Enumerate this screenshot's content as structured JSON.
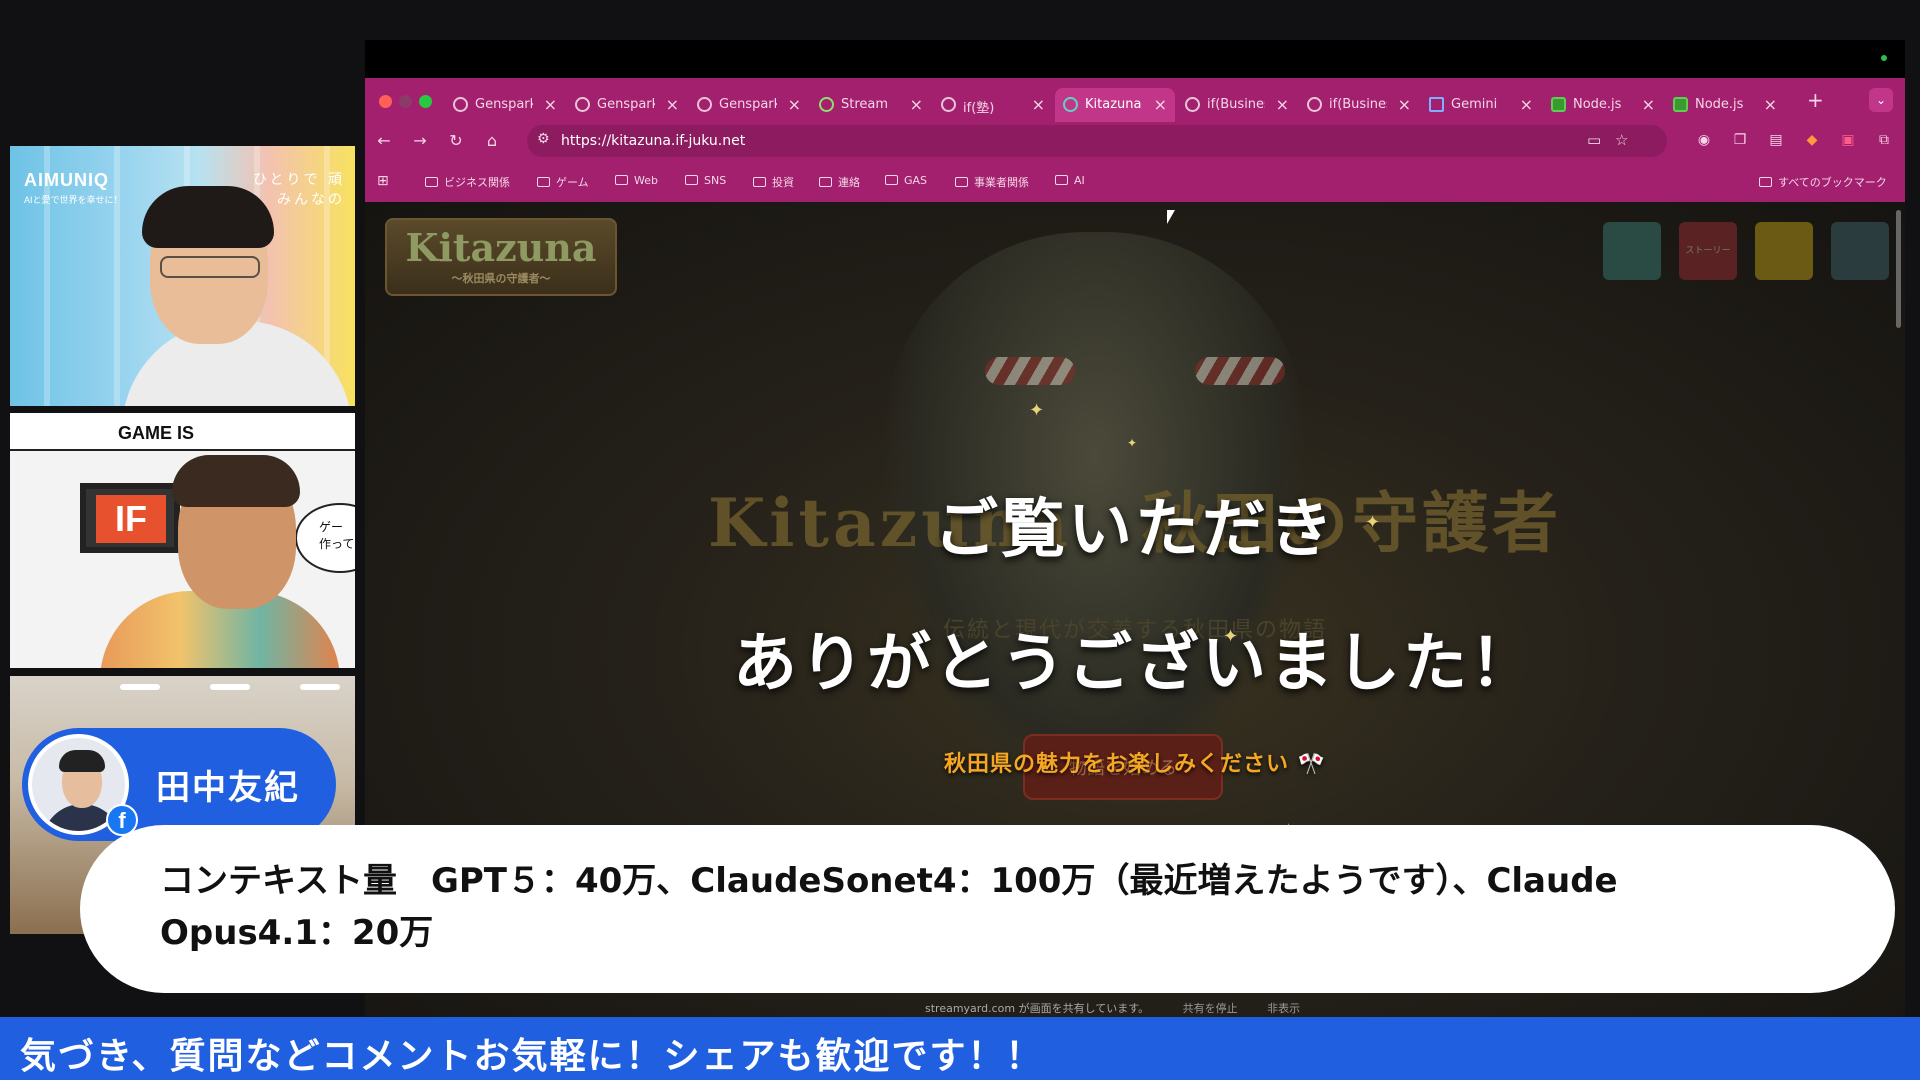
{
  "participants": [
    {
      "brand": "AIMUNIQ",
      "brand_tagline": "AIと愛で世界を幸せに！",
      "slogan_line1": "ひとりで 頑",
      "slogan_line2": "みんなの"
    },
    {
      "banner": "GAME IS",
      "speech_line1": "ゲー",
      "speech_line2": "作って",
      "logo": "IF"
    },
    {}
  ],
  "name_badge": {
    "name": "田中友紀",
    "social_icon": "facebook-icon",
    "social_glyph": "f"
  },
  "browser": {
    "tabs": [
      {
        "label": "Genspark",
        "icon": "genspark-icon"
      },
      {
        "label": "Genspark",
        "icon": "genspark-icon"
      },
      {
        "label": "Genspark",
        "icon": "genspark-icon"
      },
      {
        "label": "Stream",
        "icon": "streamyard-icon"
      },
      {
        "label": "if(塾)",
        "icon": "globe-icon"
      },
      {
        "label": "Kitazuna",
        "icon": "kitazuna-icon",
        "active": true
      },
      {
        "label": "if(Business",
        "icon": "globe-icon"
      },
      {
        "label": "if(Business",
        "icon": "globe-icon"
      },
      {
        "label": "Gemini",
        "icon": "gemini-icon"
      },
      {
        "label": "Node.js",
        "icon": "nodejs-icon"
      },
      {
        "label": "Node.js",
        "icon": "nodejs-icon"
      }
    ],
    "new_tab_glyph": "+",
    "url": "https://kitazuna.if-juku.net",
    "bookmarks": [
      "ビジネス関係",
      "ゲーム",
      "Web",
      "SNS",
      "投資",
      "連絡",
      "GAS",
      "事業者関係",
      "AI"
    ],
    "all_bookmarks": "すべてのブックマーク"
  },
  "page": {
    "game_logo": "Kitazuna",
    "game_logo_sub": "～秋田県の守護者～",
    "bg_title": "Kitazuna　秋田の守護者",
    "bg_subtitle": "伝統と現代が交差する秋田県の物語",
    "start_button": "物語を始める",
    "menu_buttons": [
      "",
      "ストーリー",
      "",
      ""
    ],
    "thanks_line1": "ご覧いただき",
    "thanks_line2": "ありがとうございました！",
    "thanks_sub": "秋田県の魅力をお楽しみください 🎌"
  },
  "share_notice": {
    "text": "streamyard.com が画面を共有しています。",
    "stop": "共有を停止",
    "hide": "非表示"
  },
  "caption": "コンテキスト量　GPT５：40万、ClaudeSonet4：100万（最近増えたようです）、Claude Opus4.1：20万",
  "ticker": "気づき、質問などコメントお気軽に！シェアも歓迎です！！",
  "colors": {
    "accent_blue": "#1f5fe0",
    "browser_chrome": "#a3206f",
    "caption_bg": "#ffffff"
  }
}
